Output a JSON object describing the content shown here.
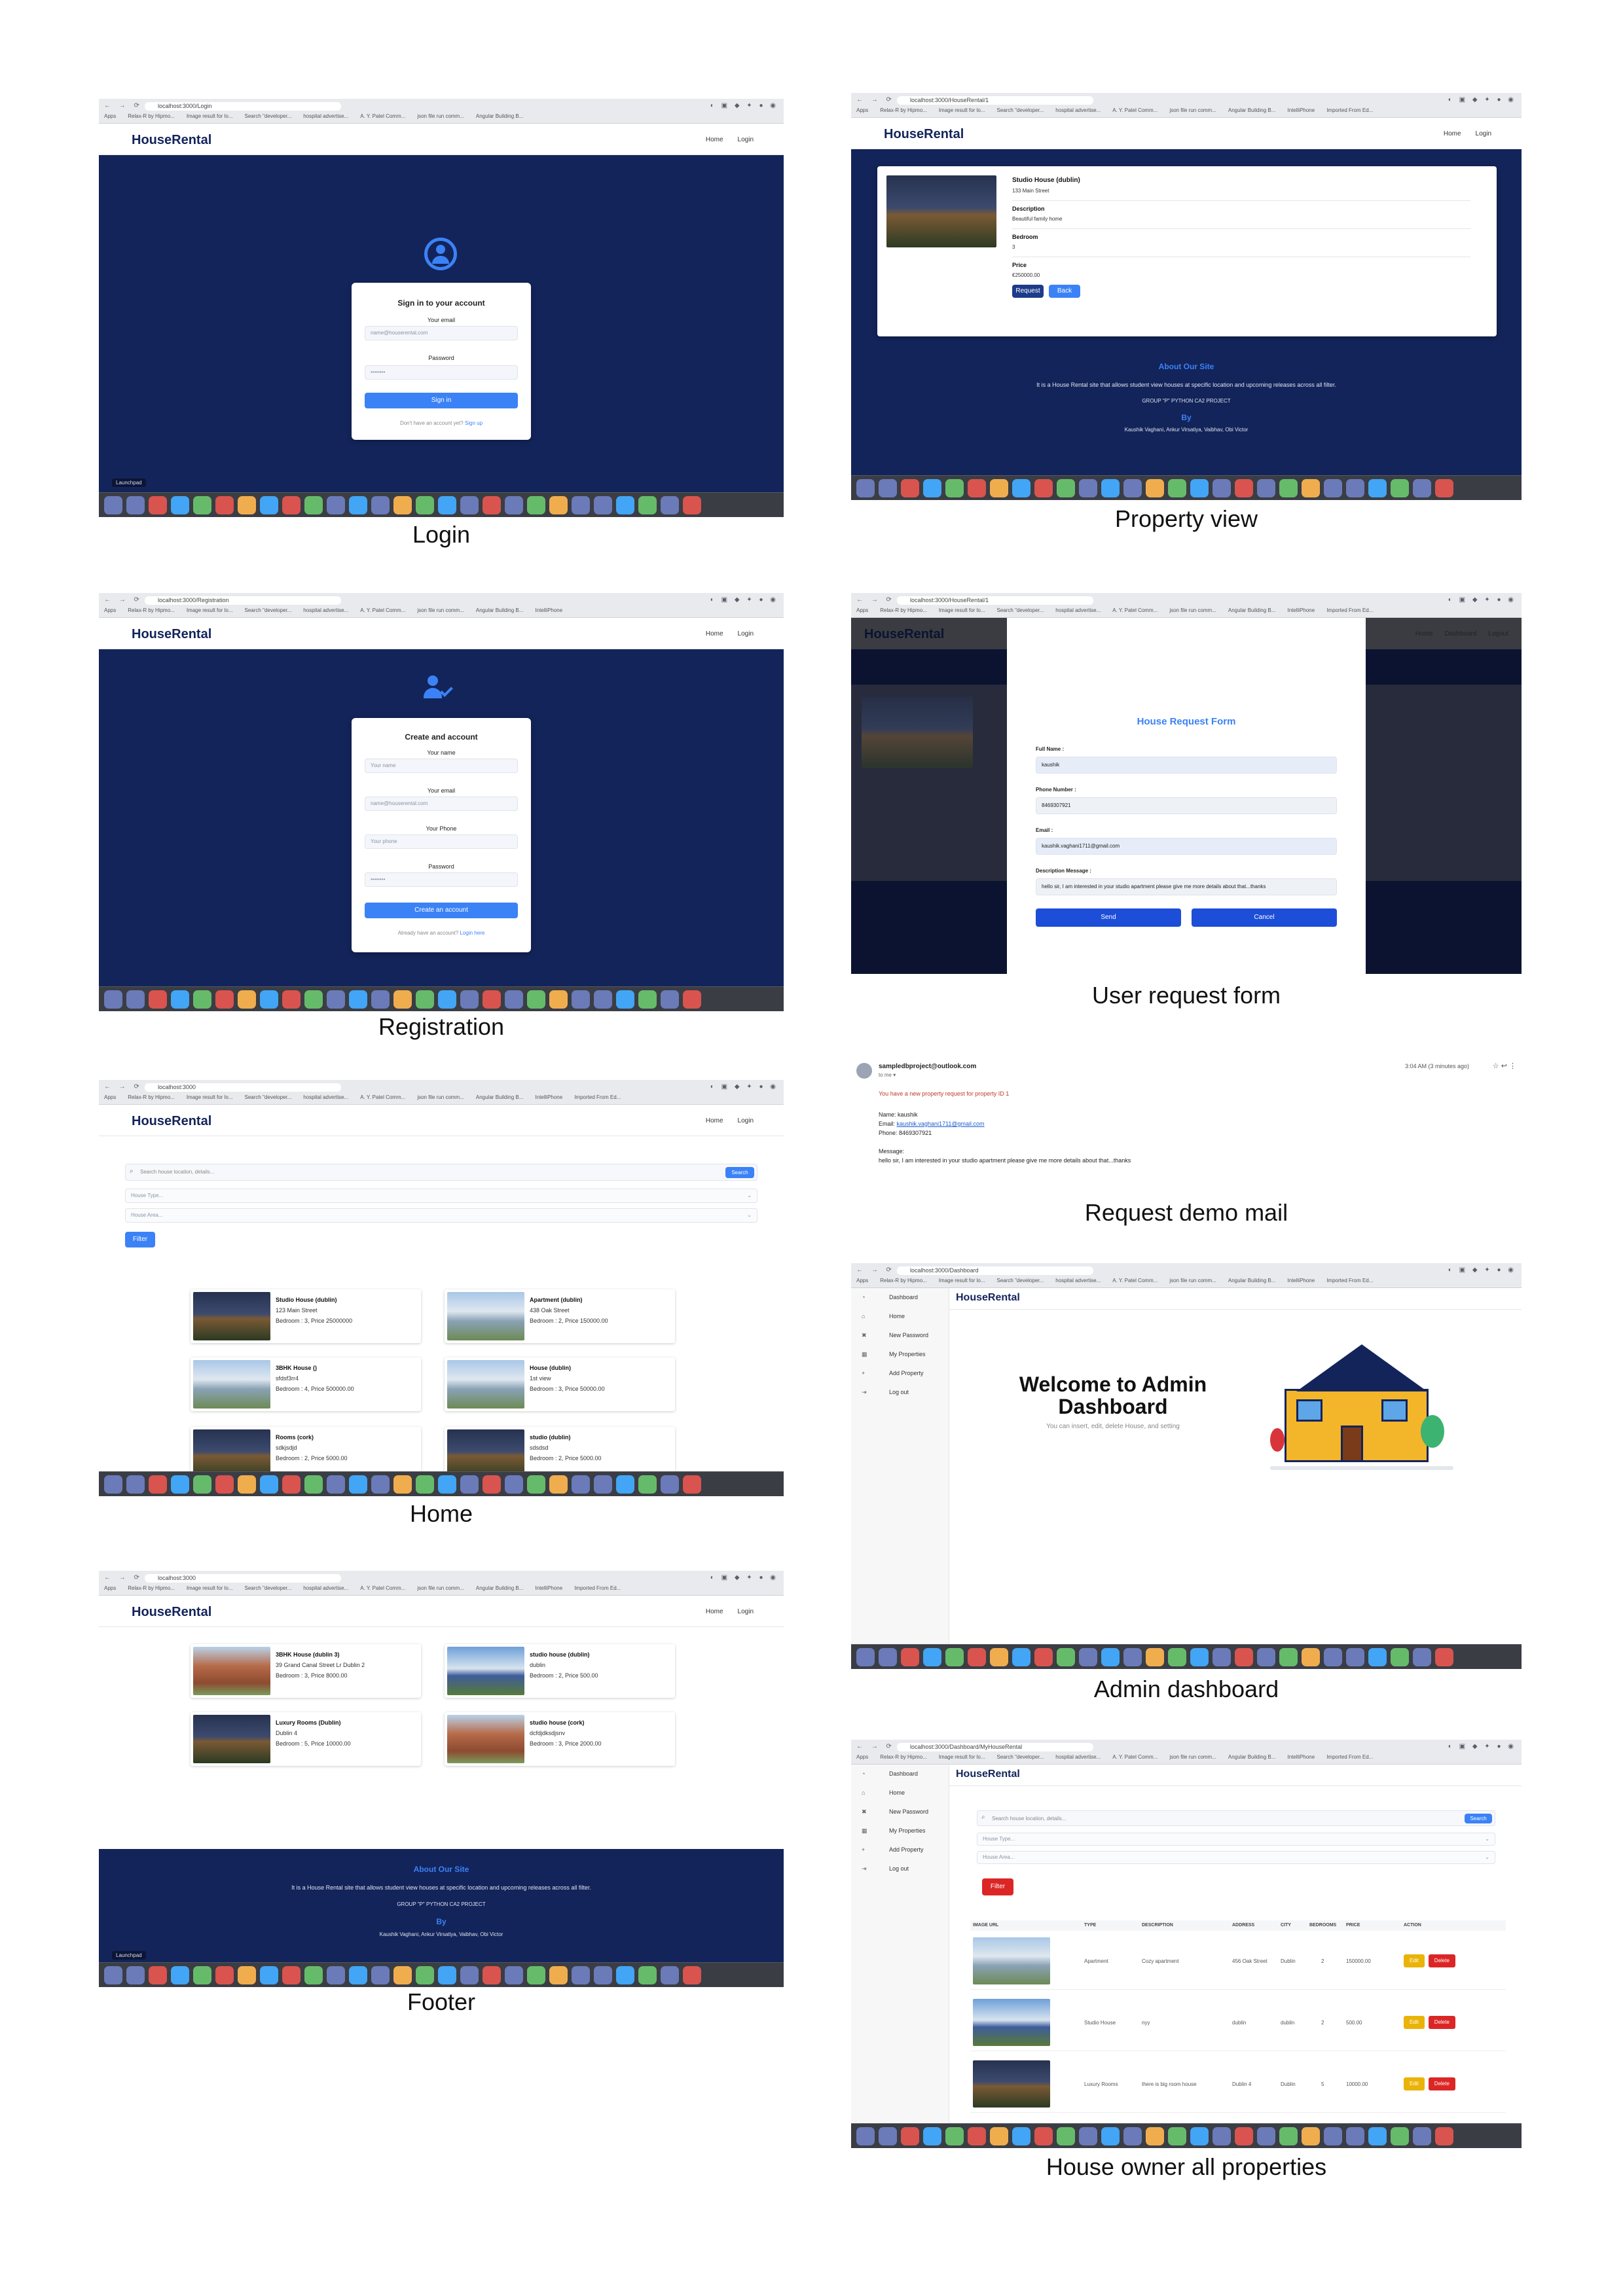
{
  "captions": {
    "login": "Login",
    "property_view": "Property view",
    "registration": "Registration",
    "user_request_form": "User request form",
    "home": "Home",
    "request_demo_mail": "Request demo mail",
    "admin_dashboard": "Admin dashboard",
    "footer": "Footer",
    "house_owner_all_properties": "House owner all properties"
  },
  "common": {
    "brand": "HouseRental",
    "menu_home": "Home",
    "menu_login": "Login",
    "url_login": "localhost:3000/Login",
    "url_property": "localhost:3000/HouseRental/1",
    "url_registration": "localhost:3000/Registration",
    "url_home": "localhost:3000",
    "url_admin": "localhost:3000/Dashboard",
    "url_owner": "localhost:3000/Dashboard/MyHouseRental",
    "launchpad": "Launchpad"
  },
  "bookmarks": [
    "Apps",
    "Relax-R by Hipmo...",
    "Image result for lo...",
    "Search \"developer...",
    "hospital advertise...",
    "A. Y. Patel Comm...",
    "json file run comm...",
    "Angular Building B...",
    "IntelliPhone",
    "Imported From Ed..."
  ],
  "login": {
    "title": "Sign in to your account",
    "email_label": "Your email",
    "email_placeholder": "name@houserental.com",
    "password_label": "Password",
    "password_placeholder": "••••••••",
    "button": "Sign in",
    "footer_text": "Don't have an account yet?",
    "footer_link": "Sign up"
  },
  "registration": {
    "title": "Create and account",
    "name_label": "Your name",
    "name_placeholder": "Your name",
    "email_label": "Your email",
    "email_placeholder": "name@houserental.com",
    "phone_label": "Your Phone",
    "phone_placeholder": "Your phone",
    "password_label": "Password",
    "password_placeholder": "••••••••",
    "button": "Create an account",
    "footer_text": "Already have an account?",
    "footer_link": "Login here"
  },
  "property_view": {
    "name": "Studio House (dublin)",
    "address": "133 Main Street",
    "desc_label": "Description",
    "desc_value": "Beautiful family home",
    "bed_label": "Bedroom",
    "bed_value": "3",
    "price_label": "Price",
    "price_value": "€250000.00",
    "request_btn": "Request",
    "back_btn": "Back",
    "about_title": "About Our Site",
    "about_text": "It is a House Rental site that allows student view houses at specific location and upcoming releases across all filter.",
    "group": "GROUP \"P\" PYTHON CA2 PROJECT",
    "by": "By",
    "authors": "Kaushik Vaghani, Ankur Virsatiya, Vaibhav, Obi Victor"
  },
  "request_form": {
    "title": "House Request Form",
    "fullname_label": "Full Name :",
    "fullname_value": "kaushik",
    "phone_label": "Phone Number :",
    "phone_value": "8469307921",
    "email_label": "Email :",
    "email_value": "kaushik.vaghani1711@gmail.com",
    "message_label": "Description Message :",
    "message_value": "hello sir, I am interested in your studio apartment please give me more details about that...thanks",
    "send_btn": "Send",
    "cancel_btn": "Cancel",
    "bg_menu": [
      "Home",
      "Dashboard",
      "Logout"
    ]
  },
  "home": {
    "search_placeholder": "Search house location, details...",
    "search_btn": "Search",
    "type_select": "House Type...",
    "area_select": "House Area...",
    "filter_btn": "Filter",
    "listings": [
      {
        "name": "Studio House (dublin)",
        "addr": "123 Main Street",
        "meta": "Bedroom : 3, Price 25000000"
      },
      {
        "name": "Apartment (dublin)",
        "addr": "438 Oak Street",
        "meta": "Bedroom : 2, Price 150000.00"
      },
      {
        "name": "3BHK House ()",
        "addr": "sfdsf3rr4",
        "meta": "Bedroom : 4, Price 500000.00"
      },
      {
        "name": "House (dublin)",
        "addr": "1st view",
        "meta": "Bedroom : 3, Price 50000.00"
      },
      {
        "name": "Rooms (cork)",
        "addr": "sdkjsdjd",
        "meta": "Bedroom : 2, Price 5000.00"
      },
      {
        "name": "studio (dublin)",
        "addr": "sdsdsd",
        "meta": "Bedroom : 2, Price 5000.00"
      }
    ]
  },
  "mail": {
    "from": "sampledbproject@outlook.com",
    "to": "to me ▾",
    "time": "3:04 AM (3 minutes ago)",
    "intro": "You have a new property request for property ID 1",
    "name_line": "Name: kaushik",
    "email_prefix": "Email: ",
    "email_link": "kaushik.vaghani1711@gmail.com",
    "phone_line": "Phone: 8469307921",
    "message_label": "Message:",
    "message_line": "hello sir, I am interested in your studio apartment please give me more details about that...thanks"
  },
  "admin": {
    "sidebar": [
      "Dashboard",
      "Home",
      "New Password",
      "My Properties",
      "Add Property",
      "Log out"
    ],
    "welcome_line1": "Welcome to Admin",
    "welcome_line2": "Dashboard",
    "subtitle": "You can insert, edit, delete House, and setting"
  },
  "footer": {
    "listings": [
      {
        "name": "3BHK House (dublin 3)",
        "addr": "39 Grand Canal Street Lr Dublin 2",
        "meta": "Bedroom : 3, Price 8000.00"
      },
      {
        "name": "studio house (dublin)",
        "addr": "dublin",
        "meta": "Bedroom : 2, Price 500.00"
      },
      {
        "name": "Luxury Rooms (Dublin)",
        "addr": "Dublin 4",
        "meta": "Bedroom : 5, Price 10000.00"
      },
      {
        "name": "studio house (cork)",
        "addr": "dcfdjdksdjsnv",
        "meta": "Bedroom : 3, Price 2000.00"
      }
    ],
    "about_title": "About Our Site",
    "about_text": "It is a House Rental site that allows student view houses at specific location and upcoming releases across all filter.",
    "group": "GROUP \"P\" PYTHON CA2 PROJECT",
    "by": "By",
    "authors": "Kaushik Vaghani, Ankur Virsatiya, Vaibhav, Obi Victor"
  },
  "owner": {
    "sidebar": [
      "Dashboard",
      "Home",
      "New Password",
      "My Properties",
      "Add Property",
      "Log out"
    ],
    "search_placeholder": "Search house location, details...",
    "search_btn": "Search",
    "type_select": "House Type...",
    "area_select": "House Area...",
    "filter_btn": "Filter",
    "columns": [
      "IMAGE URL",
      "TYPE",
      "DESCRIPTION",
      "ADDRESS",
      "CITY",
      "BEDROOMS",
      "PRICE",
      "ACTION"
    ],
    "rows": [
      {
        "type": "Apartment",
        "desc": "Cozy apartment",
        "addr": "456 Oak Street",
        "city": "Dublin",
        "bed": "2",
        "price": "150000.00"
      },
      {
        "type": "Studio House",
        "desc": "nyy",
        "addr": "dublin",
        "city": "dublin",
        "bed": "2",
        "price": "500.00"
      },
      {
        "type": "Luxury Rooms",
        "desc": "there is big room house",
        "addr": "Dublin 4",
        "city": "Dublin",
        "bed": "5",
        "price": "10000.00"
      }
    ],
    "edit_btn": "Edit",
    "delete_btn": "Delete"
  }
}
